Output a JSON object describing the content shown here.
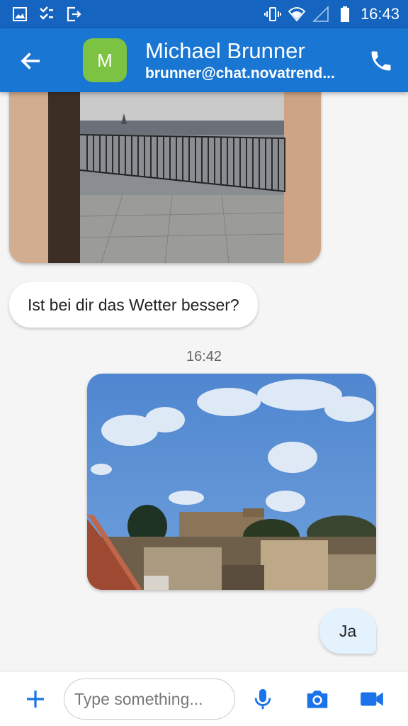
{
  "status_bar": {
    "time": "16:43",
    "left_icons": [
      "image-icon",
      "checklist-icon",
      "exit-icon"
    ],
    "right_icons": [
      "vibrate-icon",
      "wifi-icon",
      "signal-icon",
      "battery-icon"
    ]
  },
  "header": {
    "avatar_letter": "M",
    "contact_name": "Michael Brunner",
    "contact_address": "brunner@chat.novatrend..."
  },
  "messages": {
    "incoming_text": "Ist bei dir das Wetter besser?",
    "timestamp": "16:42",
    "outgoing_text": "Ja"
  },
  "composer": {
    "placeholder": "Type something..."
  },
  "colors": {
    "status_bar": "#1565c0",
    "app_bar": "#1976d2",
    "avatar": "#7cc243",
    "accent": "#1a73e8",
    "outgoing_bubble": "#e3f2fd"
  }
}
